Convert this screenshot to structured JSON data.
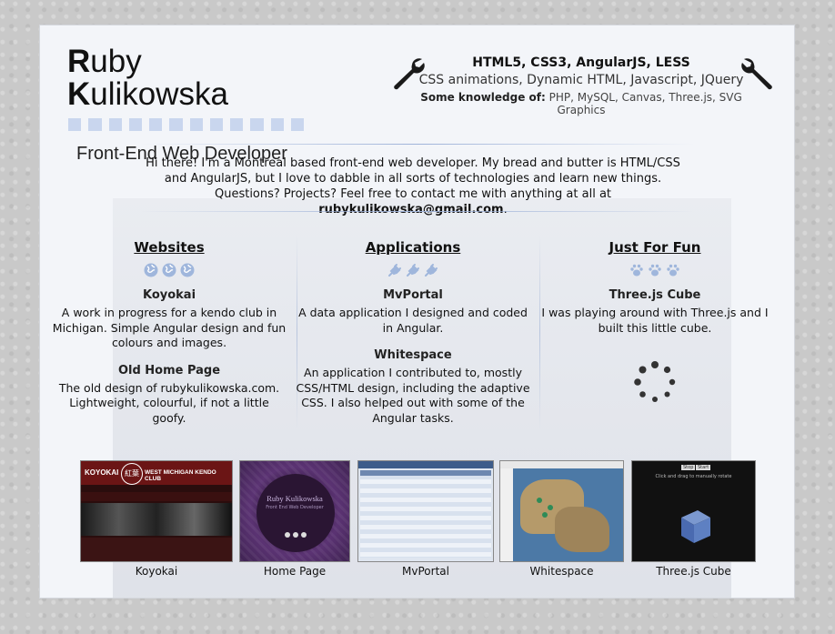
{
  "header": {
    "name_first_initial": "R",
    "name_first_rest": "uby",
    "name_last_initial": "K",
    "name_last_rest": "ulikowska",
    "subtitle": "Front-End Web Developer"
  },
  "skills": {
    "line1": "HTML5, CSS3, AngularJS, LESS",
    "line2": "CSS animations, Dynamic HTML, Javascript, JQuery",
    "line3_label": "Some knowledge of:",
    "line3_text": "PHP, MySQL, Canvas, Three.js, SVG Graphics"
  },
  "intro": {
    "text1": "Hi there! I'm a Montreal based front-end web developer. My bread and butter is HTML/CSS and AngularJS, but I love to dabble in all sorts of technologies and learn new things. Questions? Projects? Feel free to contact me with anything at all at",
    "email": "rubykulikowska@gmail.com",
    "end": "."
  },
  "columns": {
    "websites": {
      "heading": "Websites",
      "icon": "globe-icon",
      "items": [
        {
          "title": "Koyokai",
          "text": "A work in progress for a kendo club in Michigan. Simple Angular design and fun colours and images."
        },
        {
          "title": "Old Home Page",
          "text": "The old design of rubykulikowska.com. Lightweight, colourful, if not a little goofy."
        }
      ]
    },
    "applications": {
      "heading": "Applications",
      "icon": "plug-icon",
      "items": [
        {
          "title": "MvPortal",
          "text": "A data application I designed and coded in Angular."
        },
        {
          "title": "Whitespace",
          "text": "An application I contributed to, mostly CSS/HTML design, including the adaptive CSS. I also helped out with some of the Angular tasks."
        }
      ]
    },
    "fun": {
      "heading": "Just For Fun",
      "icon": "paw-icon",
      "items": [
        {
          "title": "Three.js Cube",
          "text": "I was playing around with Three.js and I built this little cube."
        }
      ]
    }
  },
  "thumbnails": [
    {
      "caption": "Koyokai",
      "banner": "KOYOKAI",
      "banner2": "WEST MICHIGAN KENDO CLUB",
      "seal": "紅葉"
    },
    {
      "caption": "Home Page",
      "inner_title": "Ruby Kulikowska",
      "inner_sub": "Front End Web Developer"
    },
    {
      "caption": "MvPortal"
    },
    {
      "caption": "Whitespace"
    },
    {
      "caption": "Three.js Cube",
      "btn1": "Stop",
      "btn2": "Start",
      "hint": "Click and drag to manually rotate"
    }
  ],
  "colors": {
    "accent_light_blue": "#c9d6ee",
    "icon_blue": "#9fb6dc",
    "text_dark": "#111111"
  }
}
